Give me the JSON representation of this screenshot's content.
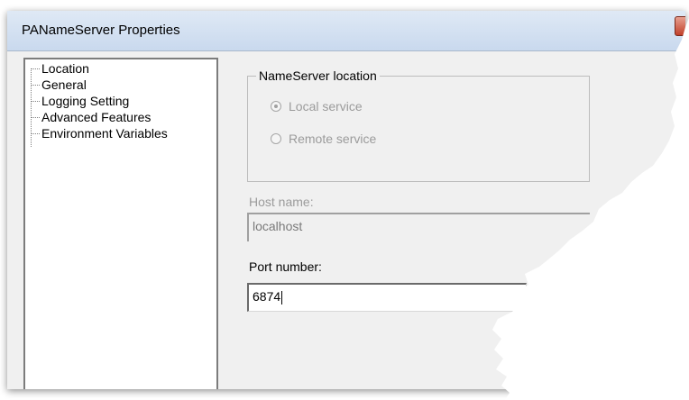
{
  "window": {
    "title": "PANameServer Properties"
  },
  "tree": {
    "items": [
      {
        "label": "Location"
      },
      {
        "label": "General"
      },
      {
        "label": "Logging Setting"
      },
      {
        "label": "Advanced Features"
      },
      {
        "label": "Environment Variables"
      }
    ]
  },
  "location_group": {
    "label": "NameServer location",
    "options": [
      {
        "label": "Local service",
        "selected": true
      },
      {
        "label": "Remote service",
        "selected": false
      }
    ]
  },
  "host": {
    "label": "Host name:",
    "value": "localhost"
  },
  "port": {
    "label": "Port number:",
    "value": "6874"
  }
}
